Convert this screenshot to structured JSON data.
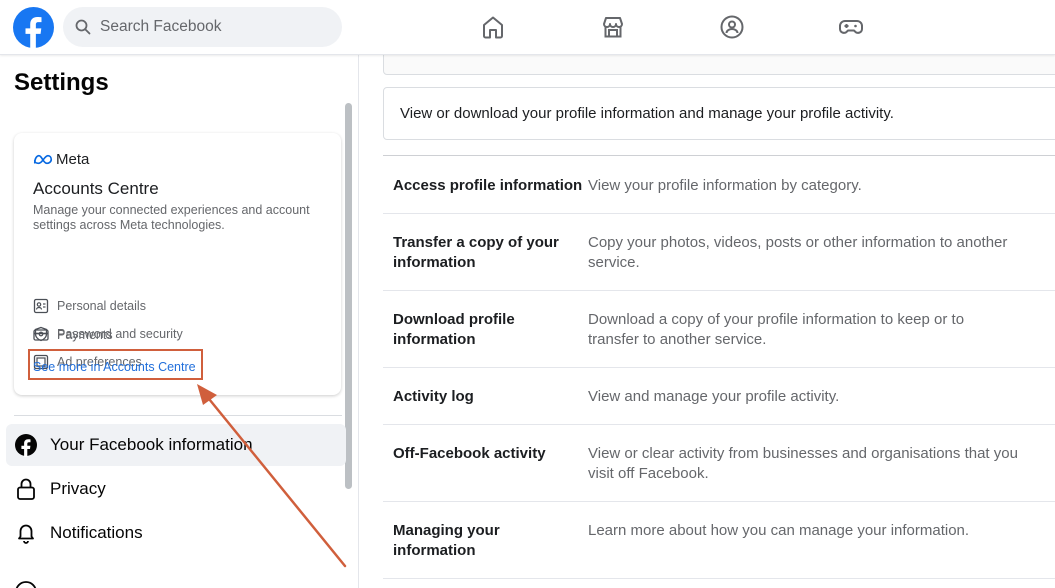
{
  "header": {
    "search_placeholder": "Search Facebook",
    "nav_icons": [
      "home-icon",
      "marketplace-icon",
      "groups-icon",
      "gaming-icon"
    ],
    "brand_color": "#1877f2"
  },
  "sidebar": {
    "title": "Settings",
    "accounts_centre": {
      "brand": "Meta",
      "title": "Accounts Centre",
      "description": "Manage your connected experiences and account settings across Meta technologies.",
      "items": [
        {
          "label": "Personal details",
          "icon": "id-card-icon"
        },
        {
          "label": "Password and security",
          "icon": "shield-icon"
        },
        {
          "label": "Ad preferences",
          "icon": "ad-icon"
        },
        {
          "label": "Payments",
          "icon": "credit-card-icon"
        }
      ],
      "link": "See more in Accounts Centre"
    },
    "menu": [
      {
        "label": "Your Facebook information",
        "icon": "facebook-icon",
        "active": true
      },
      {
        "label": "Privacy",
        "icon": "lock-icon",
        "active": false
      },
      {
        "label": "Notifications",
        "icon": "bell-icon",
        "active": false
      }
    ]
  },
  "main": {
    "intro": "View or download your profile information and manage your profile activity.",
    "rows": [
      {
        "title": "Access profile information",
        "desc": "View your profile information by category."
      },
      {
        "title": "Transfer a copy of your information",
        "desc": "Copy your photos, videos, posts or other information to another service."
      },
      {
        "title": "Download profile information",
        "desc": "Download a copy of your profile information to keep or to transfer to another service."
      },
      {
        "title": "Activity log",
        "desc": "View and manage your profile activity."
      },
      {
        "title": "Off-Facebook activity",
        "desc": "View or clear activity from businesses and organisations that you visit off Facebook."
      },
      {
        "title": "Managing your information",
        "desc": "Learn more about how you can manage your information."
      }
    ]
  },
  "annotation": {
    "color": "#d05f3c"
  }
}
